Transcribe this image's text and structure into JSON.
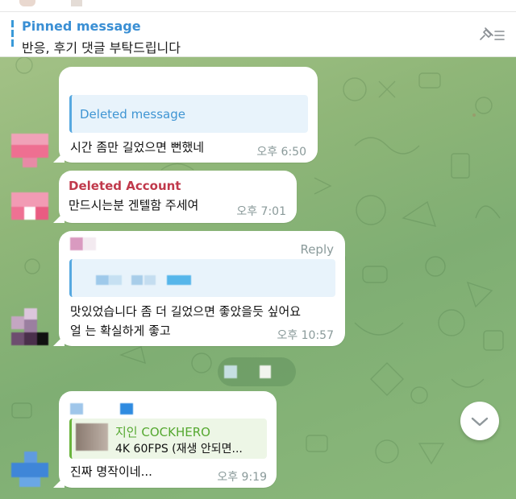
{
  "pinned": {
    "title": "Pinned message",
    "text": "반응, 후기 댓글 부탁드립니다"
  },
  "messages": [
    {
      "reply_label": "Deleted message",
      "text": "시간 좀만 길었으면     뻔했네",
      "time": "오후 6:50"
    },
    {
      "sender": "Deleted Account",
      "text": "만드시는분 겐텔함 주세여",
      "time": "오후 7:01"
    },
    {
      "reply_action": "Reply",
      "text_line1": "맛있었습니다 좀 더 길었으면 좋았을듯 싶어요",
      "text_line2": "얼   는 확실하게 좋고",
      "time": "오후 10:57"
    },
    {
      "quote_name": "지인 COCKHERO",
      "quote_text": "4K 60FPS (재생 안되면...",
      "text": "진짜 명작이네...",
      "time": "오후 9:19"
    }
  ],
  "colors": {
    "accent": "#3a8fd4",
    "deleted_account": "#c0394b",
    "quote_name": "#55a830",
    "chat_bg": "#8fb678"
  },
  "icons": {
    "pin": "unpin-icon",
    "scroll": "chevron-down-icon"
  }
}
